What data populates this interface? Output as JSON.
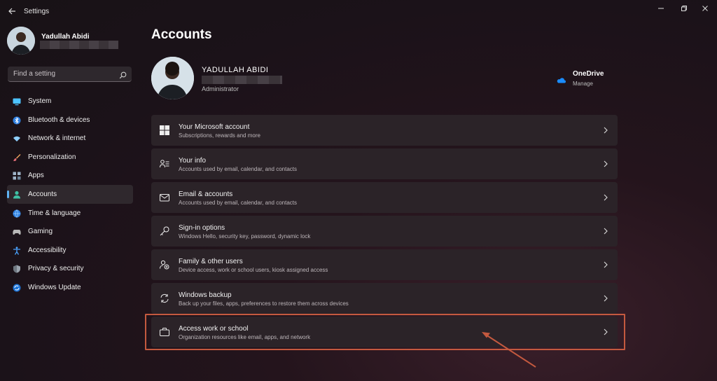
{
  "app": {
    "title": "Settings"
  },
  "profile": {
    "name": "Yadullah Abidi"
  },
  "search": {
    "placeholder": "Find a setting"
  },
  "nav": {
    "items": [
      {
        "label": "System",
        "icon": "monitor-icon",
        "color": "#4cc2ff"
      },
      {
        "label": "Bluetooth & devices",
        "icon": "bluetooth-icon",
        "color": "#4aa3ff"
      },
      {
        "label": "Network & internet",
        "icon": "wifi-icon",
        "color": "#8fd0ff"
      },
      {
        "label": "Personalization",
        "icon": "brush-icon",
        "color": "#f0a35e"
      },
      {
        "label": "Apps",
        "icon": "apps-icon",
        "color": "#9fb4c8"
      },
      {
        "label": "Accounts",
        "icon": "person-icon",
        "color": "#3fc1a5",
        "active": true
      },
      {
        "label": "Time & language",
        "icon": "globe-clock-icon",
        "color": "#4aa3ff"
      },
      {
        "label": "Gaming",
        "icon": "gamepad-icon",
        "color": "#b8b8b8"
      },
      {
        "label": "Accessibility",
        "icon": "accessibility-icon",
        "color": "#4aa3ff"
      },
      {
        "label": "Privacy & security",
        "icon": "shield-icon",
        "color": "#9aa3ad"
      },
      {
        "label": "Windows Update",
        "icon": "update-icon",
        "color": "#3aa0ff"
      }
    ]
  },
  "main": {
    "title": "Accounts",
    "account": {
      "name": "YADULLAH ABIDI",
      "role": "Administrator"
    },
    "onedrive": {
      "title": "OneDrive",
      "action": "Manage"
    },
    "cards": [
      {
        "title": "Your Microsoft account",
        "sub": "Subscriptions, rewards and more",
        "icon": "windows-logo-icon"
      },
      {
        "title": "Your info",
        "sub": "Accounts used by email, calendar, and contacts",
        "icon": "contact-card-icon"
      },
      {
        "title": "Email & accounts",
        "sub": "Accounts used by email, calendar, and contacts",
        "icon": "mail-icon"
      },
      {
        "title": "Sign-in options",
        "sub": "Windows Hello, security key, password, dynamic lock",
        "icon": "key-icon"
      },
      {
        "title": "Family & other users",
        "sub": "Device access, work or school users, kiosk assigned access",
        "icon": "family-icon"
      },
      {
        "title": "Windows backup",
        "sub": "Back up your files, apps, preferences to restore them across devices",
        "icon": "backup-sync-icon"
      },
      {
        "title": "Access work or school",
        "sub": "Organization resources like email, apps, and network",
        "icon": "briefcase-icon"
      }
    ]
  },
  "colors": {
    "accent": "#5fb2f2",
    "highlight": "#c4593f"
  }
}
